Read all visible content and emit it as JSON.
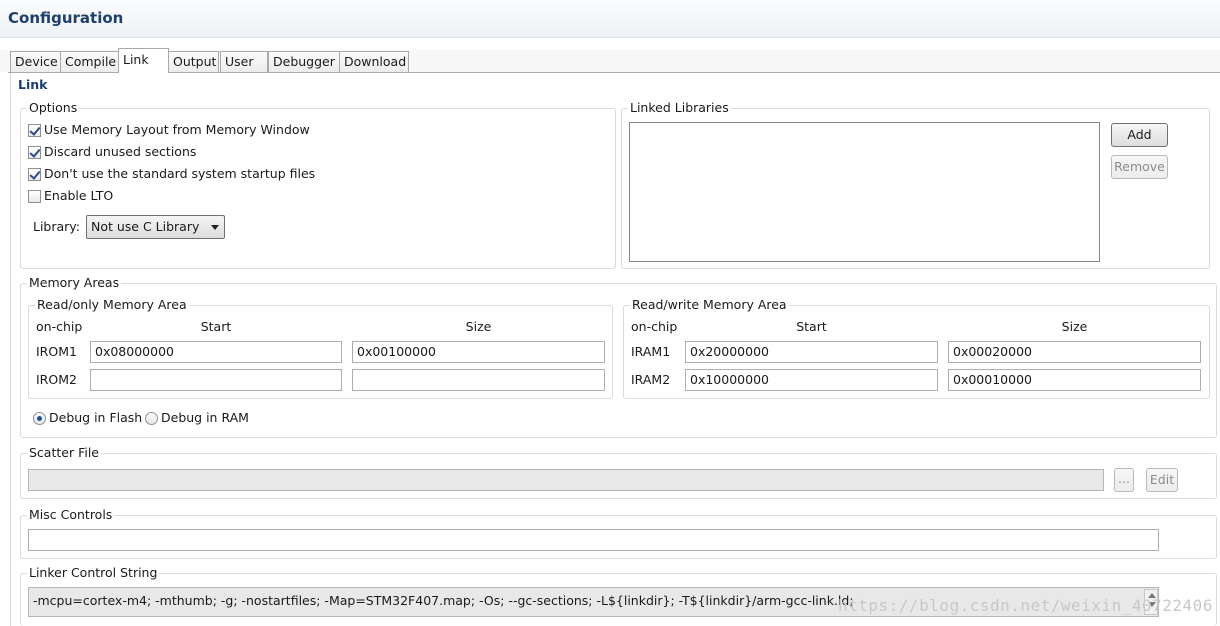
{
  "window": {
    "title": "Configuration"
  },
  "tabs": [
    {
      "label": "Device"
    },
    {
      "label": "Compile"
    },
    {
      "label": "Link",
      "active": true
    },
    {
      "label": "Output"
    },
    {
      "label": "User"
    },
    {
      "label": "Debugger"
    },
    {
      "label": "Download"
    }
  ],
  "section_title": "Link",
  "options": {
    "label": "Options",
    "checkboxes": [
      {
        "label": "Use Memory Layout from Memory Window",
        "checked": true
      },
      {
        "label": "Discard unused sections",
        "checked": true
      },
      {
        "label": "Don't use the standard system startup files",
        "checked": true
      },
      {
        "label": "Enable LTO",
        "checked": false
      }
    ],
    "library_label": "Library:",
    "library_value": "Not use C Library"
  },
  "linked_libraries": {
    "label": "Linked Libraries",
    "add_label": "Add",
    "remove_label": "Remove",
    "items": []
  },
  "memory_areas": {
    "label": "Memory Areas",
    "readonly": {
      "label": "Read/only Memory Area",
      "col_onchip": "on-chip",
      "col_start": "Start",
      "col_size": "Size",
      "rows": [
        {
          "name": "IROM1",
          "start": "0x08000000",
          "size": "0x00100000"
        },
        {
          "name": "IROM2",
          "start": "",
          "size": ""
        }
      ]
    },
    "readwrite": {
      "label": "Read/write Memory Area",
      "col_onchip": "on-chip",
      "col_start": "Start",
      "col_size": "Size",
      "rows": [
        {
          "name": "IRAM1",
          "start": "0x20000000",
          "size": "0x00020000"
        },
        {
          "name": "IRAM2",
          "start": "0x10000000",
          "size": "0x00010000"
        }
      ]
    },
    "debug_flash_label": "Debug in Flash",
    "debug_ram_label": "Debug in RAM",
    "debug_mode": "flash"
  },
  "scatter_file": {
    "label": "Scatter File",
    "value": "",
    "browse_label": "...",
    "edit_label": "Edit"
  },
  "misc_controls": {
    "label": "Misc Controls",
    "value": ""
  },
  "linker_control": {
    "label": "Linker Control String",
    "value": "-mcpu=cortex-m4; -mthumb; -g; -nostartfiles; -Map=STM32F407.map; -Os; --gc-sections; -L${linkdir}; -T${linkdir}/arm-gcc-link.ld;"
  },
  "watermark": "https://blog.csdn.net/weixin_40722406"
}
